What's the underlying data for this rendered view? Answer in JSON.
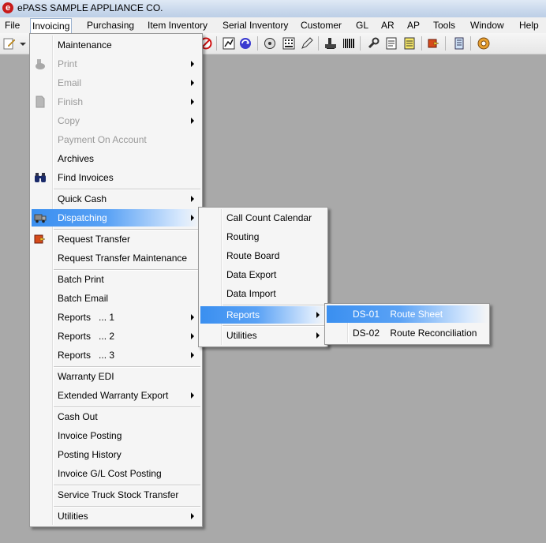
{
  "window": {
    "title": "ePASS   SAMPLE APPLIANCE CO.",
    "logo": "e"
  },
  "menubar": {
    "items": [
      {
        "label": "File"
      },
      {
        "label": "Invoicing"
      },
      {
        "label": "Purchasing"
      },
      {
        "label": "Item Inventory"
      },
      {
        "label": "Serial Inventory"
      },
      {
        "label": "Customer"
      },
      {
        "label": "GL"
      },
      {
        "label": "AR"
      },
      {
        "label": "AP"
      },
      {
        "label": "Tools"
      },
      {
        "label": "Window"
      },
      {
        "label": "Help"
      }
    ]
  },
  "toolbar": {
    "icons": [
      "edit-icon",
      "dropdown-arrow-icon",
      "no-entry-icon",
      "chart-icon",
      "refresh-icon",
      "disk-icon",
      "barcode-calculator-icon",
      "pencil-icon",
      "print-icon",
      "barcode-icon",
      "tools-icon",
      "notepad-icon",
      "note-icon",
      "export-icon",
      "list-icon",
      "help-icon"
    ]
  },
  "invoicing_menu": {
    "items": [
      {
        "label": "Maintenance",
        "enabled": true,
        "submenu": false
      },
      {
        "label": "Print",
        "enabled": false,
        "submenu": true
      },
      {
        "label": "Email",
        "enabled": false,
        "submenu": true
      },
      {
        "label": "Finish",
        "enabled": false,
        "submenu": true
      },
      {
        "label": "Copy",
        "enabled": false,
        "submenu": true
      },
      {
        "label": "Payment On Account",
        "enabled": false,
        "submenu": false
      },
      {
        "label": "Archives",
        "enabled": true,
        "submenu": false
      },
      {
        "label": "Find Invoices",
        "enabled": true,
        "submenu": false
      },
      {
        "label": "Quick Cash",
        "enabled": true,
        "submenu": true
      },
      {
        "label": "Dispatching",
        "enabled": true,
        "submenu": true,
        "highlighted": true
      },
      {
        "label": "Request Transfer",
        "enabled": true,
        "submenu": false
      },
      {
        "label": "Request Transfer Maintenance",
        "enabled": true,
        "submenu": false
      },
      {
        "label": "Batch Print",
        "enabled": true,
        "submenu": false
      },
      {
        "label": "Batch Email",
        "enabled": true,
        "submenu": false
      },
      {
        "label": "Reports",
        "suffix": "... 1",
        "enabled": true,
        "submenu": true
      },
      {
        "label": "Reports",
        "suffix": "... 2",
        "enabled": true,
        "submenu": true
      },
      {
        "label": "Reports",
        "suffix": "... 3",
        "enabled": true,
        "submenu": true
      },
      {
        "label": "Warranty EDI",
        "enabled": true,
        "submenu": false
      },
      {
        "label": "Extended Warranty Export",
        "enabled": true,
        "submenu": true
      },
      {
        "label": "Cash Out",
        "enabled": true,
        "submenu": false
      },
      {
        "label": "Invoice Posting",
        "enabled": true,
        "submenu": false
      },
      {
        "label": "Posting History",
        "enabled": true,
        "submenu": false
      },
      {
        "label": "Invoice G/L Cost Posting",
        "enabled": true,
        "submenu": false
      },
      {
        "label": "Service Truck Stock Transfer",
        "enabled": true,
        "submenu": false
      },
      {
        "label": "Utilities",
        "enabled": true,
        "submenu": true
      }
    ]
  },
  "dispatching_menu": {
    "items": [
      {
        "label": "Call Count Calendar",
        "submenu": false
      },
      {
        "label": "Routing",
        "submenu": false
      },
      {
        "label": "Route Board",
        "submenu": false
      },
      {
        "label": "Data Export",
        "submenu": false
      },
      {
        "label": "Data Import",
        "submenu": false
      },
      {
        "label": "Reports",
        "submenu": true,
        "highlighted": true
      },
      {
        "label": "Utilities",
        "submenu": true
      }
    ]
  },
  "reports_menu": {
    "items": [
      {
        "code": "DS-01",
        "label": "Route Sheet",
        "highlighted": true
      },
      {
        "code": "DS-02",
        "label": "Route Reconciliation"
      }
    ]
  },
  "colors": {
    "highlight": "#3a8ff0",
    "desktop": "#a9a9a9",
    "menu_bg": "#f5f5f5"
  }
}
